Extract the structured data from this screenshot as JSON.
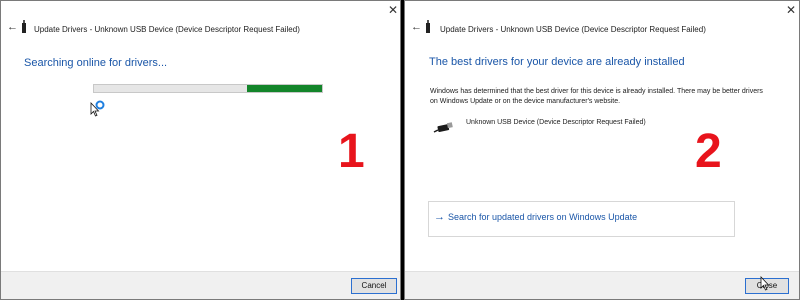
{
  "panel1": {
    "window_title": "Update Drivers - Unknown USB Device (Device Descriptor Request Failed)",
    "heading": "Searching online for drivers...",
    "progress_fraction": 0.33,
    "step_number": "1",
    "cancel_label": "Cancel"
  },
  "panel2": {
    "window_title": "Update Drivers - Unknown USB Device (Device Descriptor Request Failed)",
    "heading": "The best drivers for your device are already installed",
    "description": "Windows has determined that the best driver for this device is already installed. There may be better drivers on Windows Update or on the device manufacturer's website.",
    "device_name": "Unknown USB Device (Device Descriptor Request Failed)",
    "link_text": "Search for updated drivers on Windows Update",
    "step_number": "2",
    "close_label": "Close"
  },
  "icons": {
    "back": "back-arrow-icon",
    "close": "close-icon",
    "usb": "usb-icon",
    "link_arrow": "arrow-right-icon"
  },
  "colors": {
    "heading_blue": "#1a56a8",
    "progress_green": "#13852a",
    "step_red": "#e8141c",
    "button_border": "#2b6fd0"
  }
}
